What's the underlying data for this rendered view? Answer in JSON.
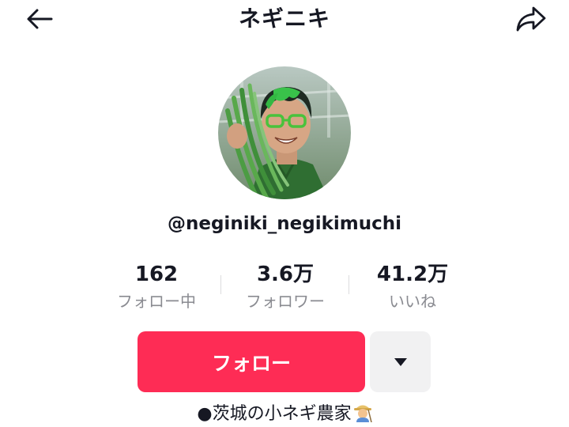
{
  "header": {
    "title": "ネギニキ",
    "back_icon": "arrow-left-icon",
    "share_icon": "share-arrow-icon"
  },
  "profile": {
    "handle": "@neginiki_negikimuchi",
    "bio_text": "●茨城の小ネギ農家",
    "bio_emoji": "farmer-emoji"
  },
  "stats": {
    "following": {
      "value": "162",
      "label": "フォロー中"
    },
    "followers": {
      "value": "3.6万",
      "label": "フォロワー"
    },
    "likes": {
      "value": "41.2万",
      "label": "いいね"
    }
  },
  "actions": {
    "follow_label": "フォロー",
    "more_icon": "caret-down-icon"
  },
  "colors": {
    "accent": "#fe2c55",
    "secondary_button": "#f1f1f2",
    "text": "#161823",
    "muted_text": "#8a8b91"
  }
}
